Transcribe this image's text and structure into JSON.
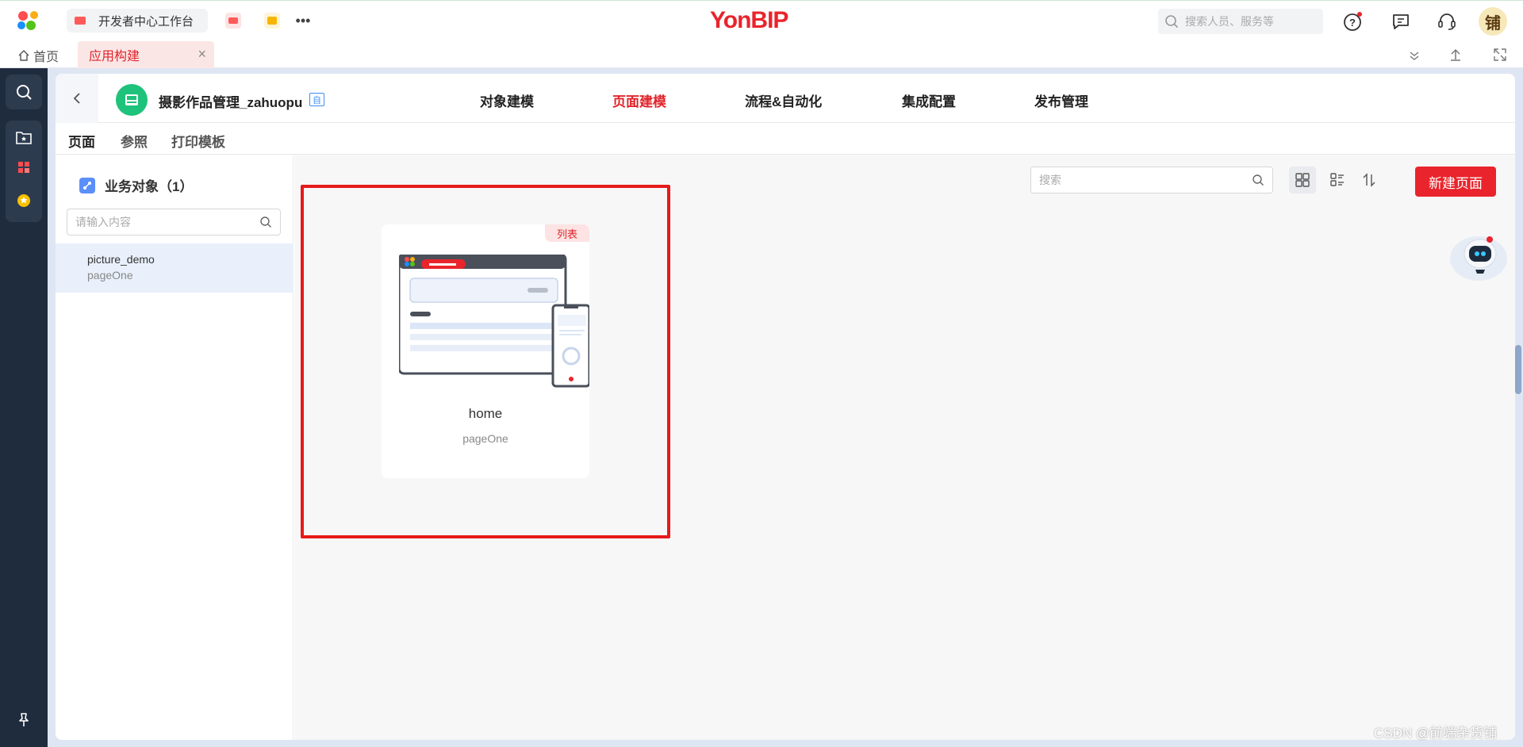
{
  "topbar": {
    "workspace_tab": "开发者中心工作台",
    "brand": "YonBIP",
    "search_placeholder": "搜索人员、服务等",
    "avatar_text": "铺"
  },
  "tabstrip": {
    "home_label": "首页",
    "active_tab_label": "应用构建",
    "close_label": "×"
  },
  "app": {
    "name": "摄影作品管理_zahuopu",
    "badge": "自",
    "nav": [
      "对象建模",
      "页面建模",
      "流程&自动化",
      "集成配置",
      "发布管理"
    ],
    "active_nav_index": 1
  },
  "subtabs": [
    "页面",
    "参照",
    "打印模板"
  ],
  "left_panel": {
    "title": "业务对象（1）",
    "search_placeholder": "请输入内容",
    "items": [
      {
        "name": "picture_demo",
        "sub": "pageOne"
      }
    ]
  },
  "content": {
    "search_placeholder": "搜索",
    "new_button_label": "新建页面",
    "cards": [
      {
        "tag": "列表",
        "title": "home",
        "sub": "pageOne"
      }
    ]
  },
  "watermark": "CSDN @前端杂货铺",
  "colors": {
    "brand_red": "#e9242c",
    "rail_dark": "#1f2c3d",
    "accent_blue": "#5b8ff9",
    "app_green": "#1ec27a"
  }
}
